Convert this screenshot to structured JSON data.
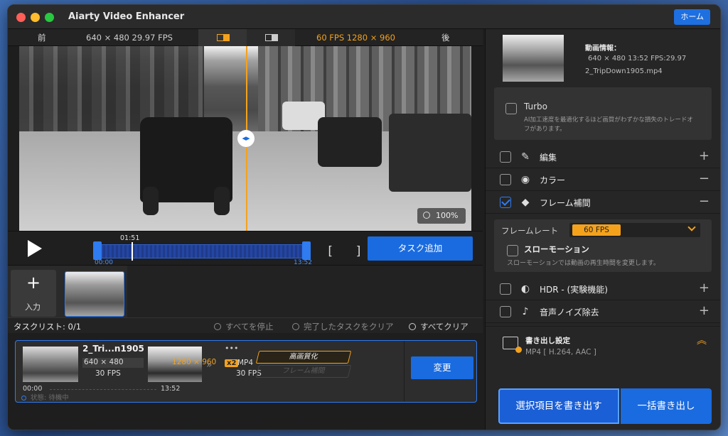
{
  "app": {
    "title": "Aiarty Video Enhancer",
    "home_label": "ホーム"
  },
  "compare_bar": {
    "before_label": "前",
    "source_info": "640 × 480   29.97 FPS",
    "output_info": "60 FPS   1280 × 960",
    "after_label": "後"
  },
  "preview": {
    "zoom": "100%"
  },
  "playback": {
    "current_time": "01:51",
    "start_time": "00:00",
    "end_time": "13:52",
    "bracket_label": "[ ]",
    "add_task_label": "タスク追加"
  },
  "input": {
    "plus": "+",
    "label": "入力"
  },
  "task_list": {
    "title": "タスクリスト: 0/1",
    "stop_all": "すべてを停止",
    "clear_done": "完了したタスクをクリア",
    "clear_all": "すべてクリア",
    "task": {
      "name": "2_Tri...n1905",
      "src_res": "640 × 480",
      "src_fps": "30 FPS",
      "time_start": "00:00",
      "time_end": "13:52",
      "out_res": "1280 × 960",
      "arrow": "»",
      "dots": "•••",
      "scale": "x2",
      "format": "MP4",
      "out_fps": "30 FPS",
      "tag_enhance": "高画質化",
      "tag_interp": "フレーム補間",
      "change_label": "変更",
      "status": "状態: 待機中"
    }
  },
  "right_panel": {
    "info_title": "動画情報：",
    "info_line": "640 × 480 13:52 FPS:29.97",
    "info_file": "2_TripDown1905.mp4",
    "turbo_label": "Turbo",
    "turbo_desc": "AI加工速度を最適化するほど画質がわずかな損失のトレードオフがあります。",
    "options": [
      {
        "label": "編集",
        "sign": "+",
        "checked": false,
        "icon": "edit-icon"
      },
      {
        "label": "カラー",
        "sign": "−",
        "checked": false,
        "icon": "palette-icon"
      },
      {
        "label": "フレーム補間",
        "sign": "−",
        "checked": true,
        "icon": "diamond-icon"
      },
      {
        "label": "HDR - (実験機能)",
        "sign": "+",
        "checked": false,
        "icon": "hdr-icon"
      },
      {
        "label": "音声ノイズ除去",
        "sign": "+",
        "checked": false,
        "icon": "mic-icon"
      }
    ],
    "frame_rate_label": "フレームレート",
    "frame_rate_value": "60 FPS",
    "slow_motion_label": "スローモーション",
    "slow_motion_desc": "スローモーションでは動画の再生時間を変更します。",
    "export_title": "書き出し設定",
    "export_format": "MP4 [ H.264, AAC ]",
    "export_selected_label": "選択項目を書き出す",
    "export_all_label": "一括書き出し"
  },
  "colors": {
    "accent_blue": "#1a6be0",
    "accent_orange": "#f4a21c"
  }
}
